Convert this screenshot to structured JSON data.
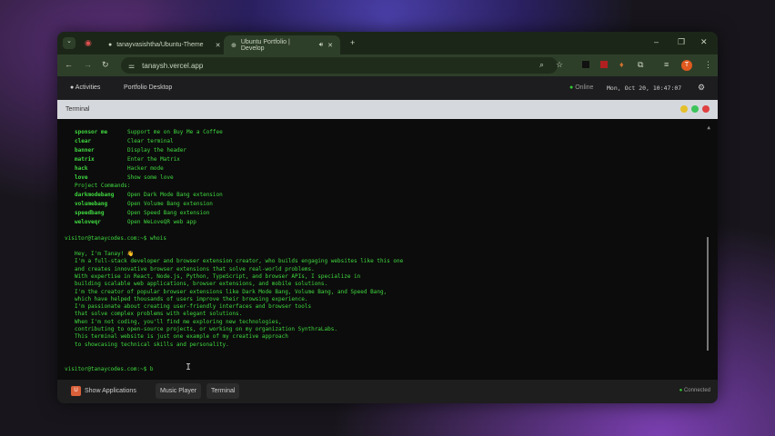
{
  "browser": {
    "tabs": [
      {
        "title": "tanayvasishtha/Ubuntu-Theme"
      },
      {
        "title": "Ubuntu Portfolio | Develop"
      }
    ],
    "url": "tanaysh.vercel.app"
  },
  "topbar": {
    "activities": "Activities",
    "title": "Portfolio Desktop",
    "status": "Online",
    "datetime": "Mon, Oct 20, 10:47:07"
  },
  "terminal": {
    "title": "Terminal",
    "commands": [
      [
        "sponsor me",
        "Support me on Buy Me a Coffee"
      ],
      [
        "clear",
        "Clear terminal"
      ],
      [
        "banner",
        "Display the header"
      ],
      [
        "matrix",
        "Enter the Matrix"
      ],
      [
        "hack",
        "Hacker mode"
      ],
      [
        "love",
        "Show some love"
      ]
    ],
    "project_header": "Project Commands:",
    "project_commands": [
      [
        "darkmodebang",
        "Open Dark Mode Bang extension"
      ],
      [
        "volumebang",
        "Open Volume Bang extension"
      ],
      [
        "speedbang",
        "Open Speed Bang extension"
      ],
      [
        "weloveqr",
        "Open WeLoveQR web app"
      ]
    ],
    "prompt1": "visitor@tanaycodes.com:~$ whois",
    "output": [
      "Hey, I'm Tanay! 👋",
      "I'm a full-stack developer and browser extension creator, who builds engaging websites like this one",
      "and creates innovative browser extensions that solve real-world problems.",
      "With expertise in React, Node.js, Python, TypeScript, and browser APIs, I specialize in",
      "building scalable web applications, browser extensions, and mobile solutions.",
      "I'm the creator of popular browser extensions like Dark Mode Bang, Volume Bang, and Speed Bang,",
      "which have helped thousands of users improve their browsing experience.",
      "I'm passionate about creating user-friendly interfaces and browser tools",
      "that solve complex problems with elegant solutions.",
      "When I'm not coding, you'll find me exploring new technologies,",
      "contributing to open-source projects, or working on my organization SynthraLabs.",
      "This terminal website is just one example of my creative approach",
      "to showcasing technical skills and personality."
    ],
    "prompt2": "visitor@tanaycodes.com:~$ b"
  },
  "taskbar": {
    "show_apps": "Show Applications",
    "apps": [
      "Music Player",
      "Terminal"
    ],
    "status": "Connected"
  }
}
